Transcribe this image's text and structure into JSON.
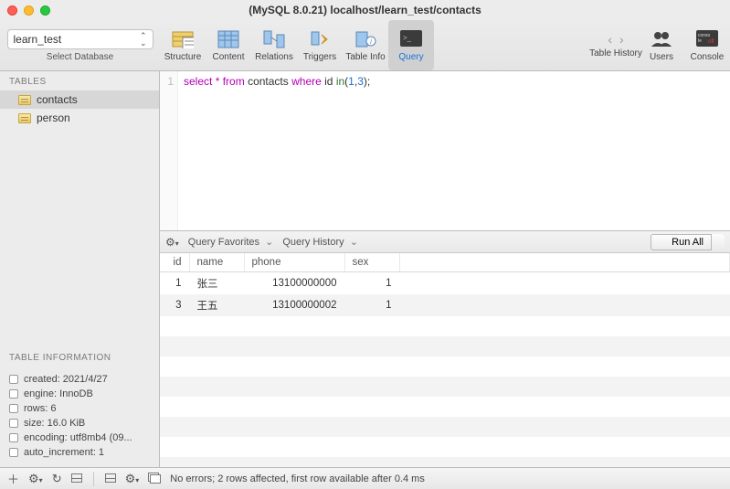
{
  "window": {
    "title": "(MySQL 8.0.21) localhost/learn_test/contacts"
  },
  "db_selector": {
    "value": "learn_test",
    "label": "Select Database"
  },
  "toolbar": {
    "structure": "Structure",
    "content": "Content",
    "relations": "Relations",
    "triggers": "Triggers",
    "tableinfo": "Table Info",
    "query": "Query",
    "history": "Table History",
    "users": "Users",
    "console": "Console"
  },
  "sidebar": {
    "header": "TABLES",
    "tables": [
      "contacts",
      "person"
    ],
    "info_header": "TABLE INFORMATION",
    "info": [
      "created: 2021/4/27",
      "engine: InnoDB",
      "rows: 6",
      "size: 16.0 KiB",
      "encoding: utf8mb4 (09...",
      "auto_increment: 1"
    ]
  },
  "editor": {
    "line_no": "1",
    "tokens": {
      "select": "select",
      "star": "*",
      "from": "from",
      "table": "contacts",
      "where": "where",
      "col": "id",
      "in": "in",
      "lp": "(",
      "n1": "1",
      "comma": ",",
      "n3": "3",
      "rp": ")",
      "semi": ";"
    }
  },
  "midbar": {
    "favorites": "Query Favorites",
    "history": "Query History",
    "runall": "Run All"
  },
  "results": {
    "columns": [
      "id",
      "name",
      "phone",
      "sex"
    ],
    "rows": [
      {
        "id": "1",
        "name": "张三",
        "phone": "13100000000",
        "sex": "1"
      },
      {
        "id": "3",
        "name": "王五",
        "phone": "13100000002",
        "sex": "1"
      }
    ]
  },
  "status": {
    "text": "No errors; 2 rows affected, first row available after 0.4 ms"
  }
}
